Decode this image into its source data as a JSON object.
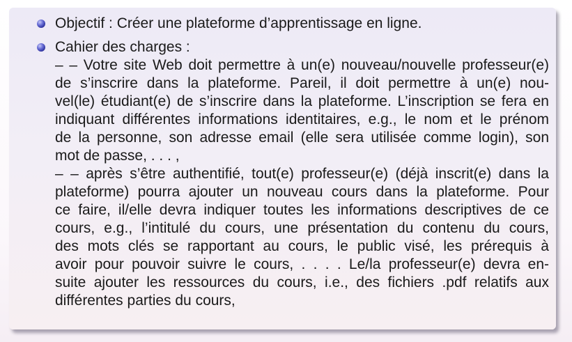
{
  "bullets": [
    {
      "lines": [
        "Objectif : Créer une plateforme d’apprentissage en ligne."
      ]
    },
    {
      "heading": "Cahier des charges :",
      "lines": [
        "– – Votre site Web doit permettre à un(e) nouveau/nouvelle professeur(e)",
        "de s’inscrire dans la plateforme.  Pareil, il doit permettre à un(e) nou-",
        "vel(le) étudiant(e) de s’inscrire dans la plateforme. L’inscription se fera en",
        "indiquant différentes informations identitaires, e.g., le nom et le prénom",
        "de la personne, son adresse email (elle sera utilisée comme login), son",
        "mot de passe, . . . ,",
        "– – après s’être authentifié, tout(e) professeur(e) (déjà inscrit(e) dans la",
        "plateforme) pourra ajouter un nouveau cours dans la plateforme.  Pour",
        "ce faire, il/elle devra indiquer toutes les informations descriptives de ce",
        "cours, e.g., l’intitulé du cours, une présentation du contenu du cours,",
        "des mots clés se rapportant au cours, le public visé, les prérequis à",
        "avoir pour pouvoir suivre le cours, . . . .  Le/la professeur(e) devra en-",
        "suite ajouter les ressources du cours, i.e., des fichiers .pdf relatifs aux",
        "différentes parties du cours,"
      ]
    }
  ]
}
